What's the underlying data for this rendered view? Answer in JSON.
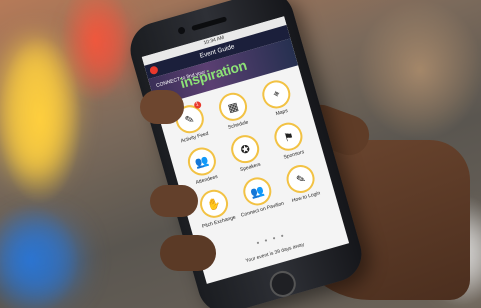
{
  "status_bar": {
    "time": "10:34 AM"
  },
  "header": {
    "title": "Event Guide"
  },
  "banner": {
    "small_text": "CONNECT to find your",
    "big_text": "inspiration"
  },
  "tiles": [
    {
      "icon": "activity-feed-icon",
      "glyph": "✎",
      "label": "Activity Feed",
      "badge": "1"
    },
    {
      "icon": "schedule-icon",
      "glyph": "▦",
      "label": "Schedule"
    },
    {
      "icon": "maps-icon",
      "glyph": "⌖",
      "label": "Maps"
    },
    {
      "icon": "attendees-icon",
      "glyph": "👥",
      "label": "Attendees"
    },
    {
      "icon": "speakers-icon",
      "glyph": "✪",
      "label": "Speakers"
    },
    {
      "icon": "sponsors-icon",
      "glyph": "⚑",
      "label": "Sponsors"
    },
    {
      "icon": "pitch-exchange-icon",
      "glyph": "✋",
      "label": "Pitch Exchange"
    },
    {
      "icon": "connect-on-pavilion-icon",
      "glyph": "👥",
      "label": "Connect on Pavilion"
    },
    {
      "icon": "how-to-login-icon",
      "glyph": "✎",
      "label": "How to Login"
    }
  ],
  "pager": {
    "dots": "● ● ● ●"
  },
  "footer": {
    "text": "Your event is 39 days away"
  },
  "colors": {
    "header": "#1b1f3a",
    "icon_ring": "#f0c24a",
    "banner_text": "#8fe07a",
    "badge": "#e23a2e"
  }
}
